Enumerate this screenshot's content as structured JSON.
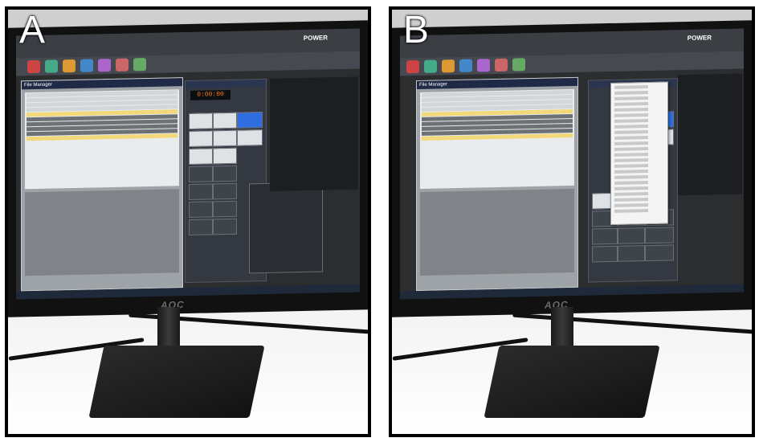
{
  "panels": [
    {
      "label": "A",
      "app_title": "POWER",
      "window_title": "File Manager",
      "clock": "0:00:00",
      "context_menu": false
    },
    {
      "label": "B",
      "app_title": "POWER",
      "window_title": "File Manager",
      "clock": "",
      "context_menu": true
    }
  ],
  "monitor_brand": "AOC",
  "colors": {
    "frame": "#000000",
    "app_bg": "#2b2d2f",
    "file_manager": "#9ea3a8",
    "highlight_cell": "#2f6de0",
    "clock_text": "#ff7a1a"
  }
}
